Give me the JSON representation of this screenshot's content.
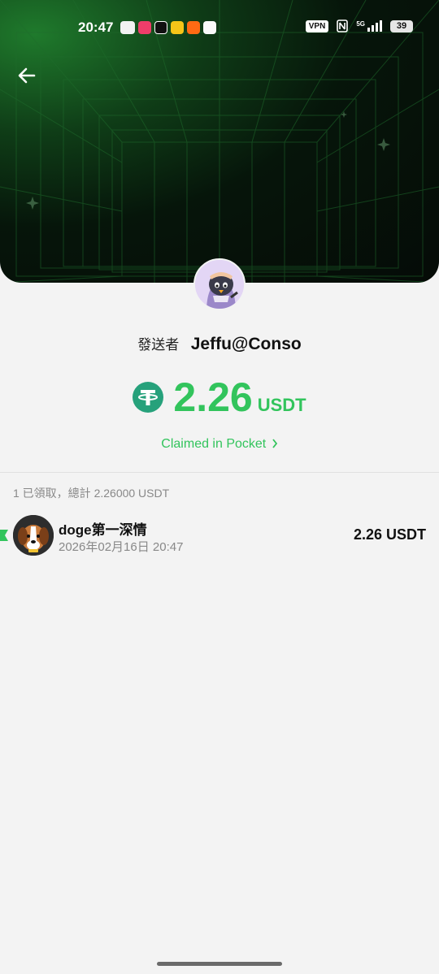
{
  "status_bar": {
    "time": "20:47",
    "vpn": "VPN",
    "network": "5G",
    "battery": "39"
  },
  "header": {
    "back_icon": "arrow-left-icon"
  },
  "packet": {
    "sender_label": "發送者",
    "sender_name": "Jeffu@Conso",
    "amount": "2.26",
    "currency": "USDT",
    "claimed_link": "Claimed in Pocket",
    "accent_color": "#32c45c"
  },
  "summary": {
    "text": "1 已領取，總計 2.26000 USDT"
  },
  "claims": [
    {
      "name": "doge第一深情",
      "time": "2026年02月16日 20:47",
      "amount": "2.26 USDT"
    }
  ]
}
